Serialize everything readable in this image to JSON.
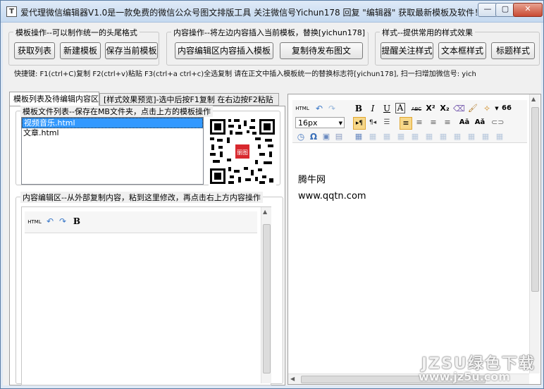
{
  "window": {
    "title": "爱代理微信编辑器V1.0是一款免费的微信公众号图文排版工具 关注微信号Yichun178 回复 \"编辑器\" 获取最新模板及软件！",
    "app_icon": "T",
    "controls": {
      "minimize": "—",
      "maximize": "▢",
      "close": "✕"
    }
  },
  "groups": {
    "template": {
      "title": "模板操作--可以制作统一的头尾格式",
      "buttons": [
        "获取列表",
        "新建模板",
        "保存当前模板"
      ]
    },
    "content": {
      "title": "内容操作--将左边内容插入当前模板，替换[yichun178]",
      "buttons": [
        "内容编辑区内容插入模板",
        "复制待发布图文"
      ]
    },
    "style": {
      "title": "样式--提供常用的样式效果",
      "buttons": [
        "提醒关注样式",
        "文本框样式",
        "标题样式"
      ]
    }
  },
  "hint": "快捷键: F1(ctrl+C)复制  F2(ctrl+v)粘贴 F3(ctrl+a ctrl+c)全选复制    请在正文中插入模板统一的替换标志符[yichun178],  扫一扫增加微信号: yich",
  "tabs": {
    "active": "模板列表及待编辑内容区",
    "inactive": "[样式效果预览]-选中后按F1复制 在右边按F2粘贴"
  },
  "template_list": {
    "title": "模板文件列表--保存在MB文件夹，点击上方的模板操作",
    "items": [
      {
        "label": "视频音乐.html",
        "selected": true
      },
      {
        "label": "文章.html",
        "selected": false
      }
    ]
  },
  "qr": {
    "badge": "丽图"
  },
  "content_editor": {
    "title": "内容编辑区--从外部复制内容，粘到这里修改，再点击右上方内容操作",
    "toolbar": {
      "html": "HTML",
      "undo": "↶",
      "redo": "↷",
      "bold": "B"
    }
  },
  "right_editor": {
    "toolbar": {
      "html": "HTML",
      "undo": "↶",
      "redo": "↷",
      "bold": "B",
      "italic": "I",
      "underline": "U",
      "fontcolor": "A",
      "strike": "ABC",
      "sup": "X²",
      "sub": "X₂",
      "clear": "⌫",
      "brush": "🖌",
      "more": "✧",
      "quote": "66",
      "font_size": "16px",
      "omega": "Ω"
    },
    "content_lines": [
      "腾牛网",
      "www.qqtn.com"
    ]
  },
  "watermark": {
    "line1": "JZSU绿色下载",
    "line2": "www.jz5u.com"
  },
  "colors": {
    "accent_selected": "#3399ff",
    "close_button": "#c94a33",
    "title_bar": "#c5d9f0"
  }
}
